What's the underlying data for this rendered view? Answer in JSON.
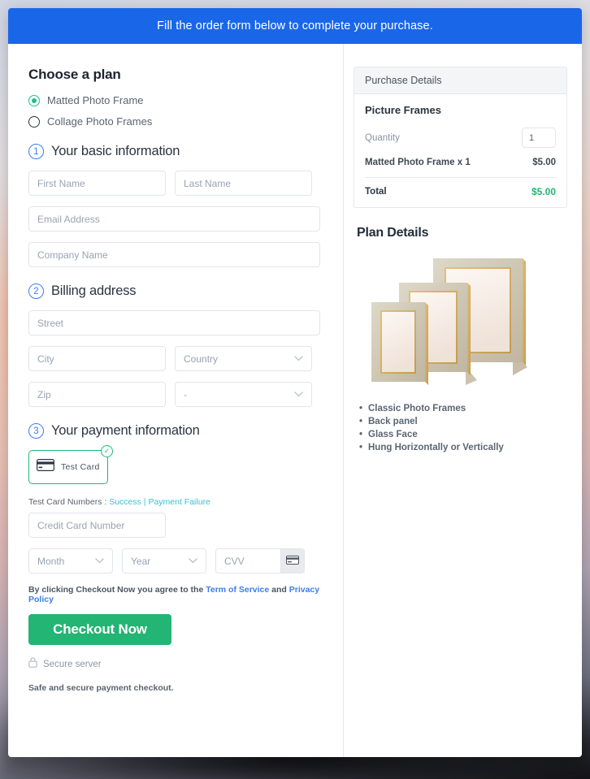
{
  "banner": {
    "text": "Fill the order form below to complete your purchase."
  },
  "plan": {
    "heading": "Choose a plan",
    "options": [
      {
        "label": "Matted Photo Frame",
        "selected": true
      },
      {
        "label": "Collage Photo Frames",
        "selected": false
      }
    ]
  },
  "steps": {
    "basic": {
      "num": "1",
      "title": "Your basic information"
    },
    "billing": {
      "num": "2",
      "title": "Billing address"
    },
    "payment": {
      "num": "3",
      "title": "Your payment information"
    }
  },
  "fields": {
    "first_name": "First Name",
    "last_name": "Last Name",
    "email": "Email Address",
    "company": "Company Name",
    "street": "Street",
    "city": "City",
    "country": "Country",
    "zip": "Zip",
    "state": "-",
    "credit_card": "Credit Card Number",
    "month": "Month",
    "year": "Year",
    "cvv": "CVV"
  },
  "payment": {
    "test_card_label": "Test  Card",
    "test_numbers_prefix": "Test Card Numbers : ",
    "success_link": "Success",
    "separator": " | ",
    "failure_link": "Payment Failure"
  },
  "footer": {
    "agree_prefix": "By clicking Checkout Now you agree to the ",
    "terms_link": "Term of Service",
    "agree_middle": " and ",
    "privacy_link": "Privacy Policy",
    "checkout_label": "Checkout Now",
    "secure_server": "Secure server",
    "safe_text": "Safe and secure payment checkout."
  },
  "purchase": {
    "header": "Purchase Details",
    "product": "Picture Frames",
    "quantity_label": "Quantity",
    "quantity_value": "1",
    "line_item_label": "Matted Photo Frame x 1",
    "line_item_amount": "$5.00",
    "total_label": "Total",
    "total_amount": "$5.00"
  },
  "plan_details": {
    "heading": "Plan Details",
    "features": [
      "Classic Photo Frames",
      "Back panel",
      "Glass Face",
      "Hung Horizontally or Vertically"
    ]
  },
  "colors": {
    "banner_blue": "#1a66e8",
    "accent_green": "#22b573",
    "link_blue": "#3b7df0",
    "link_teal": "#36c2d4",
    "step_blue": "#3b7df0"
  }
}
